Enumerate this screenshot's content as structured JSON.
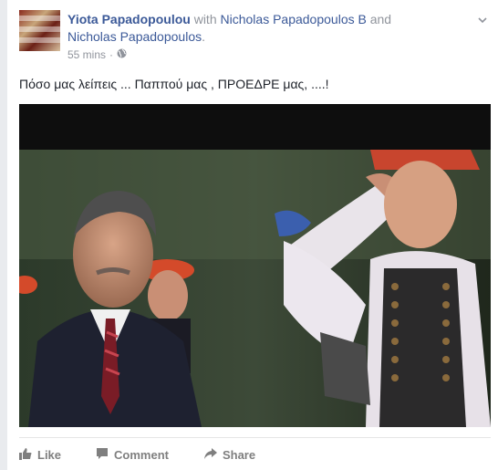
{
  "post": {
    "author": "Yiota Papadopoulou",
    "with_word": "with",
    "tagged_1": "Nicholas Papadopoulos B",
    "and_word": "and",
    "tagged_2": "Nicholas Papadopoulos",
    "period": ".",
    "time": "55 mins",
    "separator": "·",
    "text": "Πόσο μας λείπεις ... Παππού μας , ΠΡΟΕΔΡΕ μας, ....!"
  },
  "actions": {
    "like": "Like",
    "comment": "Comment",
    "share": "Share"
  },
  "icons": {
    "privacy": "globe-icon",
    "menu": "chevron-down-icon",
    "like": "thumbs-up-icon",
    "comment": "comment-icon",
    "share": "share-arrow-icon"
  },
  "colors": {
    "link": "#3b5998",
    "meta": "#90949c",
    "action": "#7f7f7f"
  }
}
